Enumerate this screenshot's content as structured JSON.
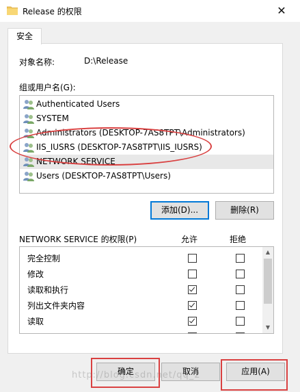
{
  "window": {
    "title": "Release 的权限",
    "close_glyph": "✕"
  },
  "tab": {
    "label": "安全"
  },
  "object": {
    "label": "对象名称:",
    "value": "D:\\Release"
  },
  "groups": {
    "label": "组或用户名(G):",
    "items": [
      {
        "label": "Authenticated Users",
        "selected": false
      },
      {
        "label": "SYSTEM",
        "selected": false
      },
      {
        "label": "Administrators (DESKTOP-7AS8TPT\\Administrators)",
        "selected": false
      },
      {
        "label": "IIS_IUSRS (DESKTOP-7AS8TPT\\IIS_IUSRS)",
        "selected": false
      },
      {
        "label": "NETWORK SERVICE",
        "selected": true
      },
      {
        "label": "Users (DESKTOP-7AS8TPT\\Users)",
        "selected": false
      }
    ]
  },
  "group_buttons": {
    "add": "添加(D)...",
    "remove": "删除(R)"
  },
  "permissions": {
    "title": "NETWORK SERVICE 的权限(P)",
    "allow_header": "允许",
    "deny_header": "拒绝",
    "items": [
      {
        "label": "完全控制",
        "allow": false,
        "deny": false
      },
      {
        "label": "修改",
        "allow": false,
        "deny": false
      },
      {
        "label": "读取和执行",
        "allow": true,
        "deny": false
      },
      {
        "label": "列出文件夹内容",
        "allow": true,
        "deny": false
      },
      {
        "label": "读取",
        "allow": true,
        "deny": false
      },
      {
        "label": "写入",
        "allow": false,
        "deny": false
      }
    ]
  },
  "dialog_buttons": {
    "ok": "确定",
    "cancel": "取消",
    "apply": "应用(A)"
  },
  "watermark": "http://blog.csdn.net/qq_2",
  "colors": {
    "highlight_red": "#d94040",
    "focus_blue": "#0078d7",
    "selected_row": "#e8e8e8"
  }
}
